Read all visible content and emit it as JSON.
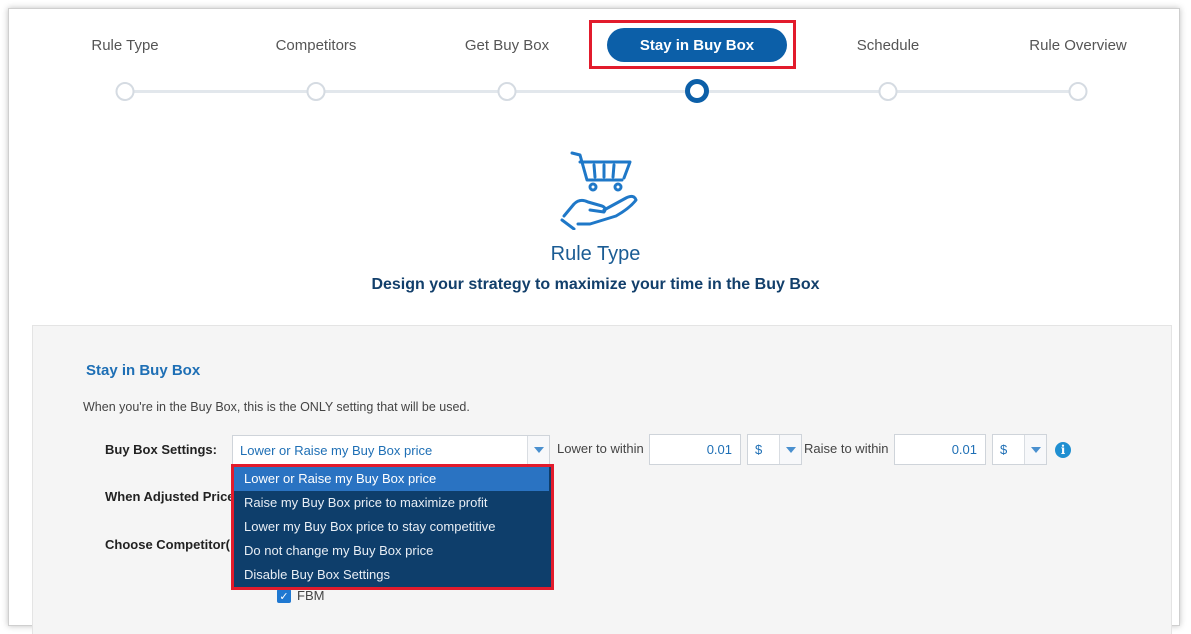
{
  "steps": [
    {
      "label": "Rule Type"
    },
    {
      "label": "Competitors"
    },
    {
      "label": "Get Buy Box"
    },
    {
      "label": "Stay in Buy Box",
      "active": true
    },
    {
      "label": "Schedule"
    },
    {
      "label": "Rule Overview"
    }
  ],
  "hero": {
    "icon": "cart-in-hand-icon",
    "title": "Rule Type",
    "subtitle": "Design your strategy to maximize your time in the Buy Box"
  },
  "section": {
    "title": "Stay in Buy Box",
    "description": "When you're in the Buy Box, this is the ONLY setting that will be used."
  },
  "form": {
    "buy_box_label": "Buy Box Settings:",
    "buy_box_value": "Lower or Raise my Buy Box price",
    "lower_label": "Lower to within",
    "lower_value": "0.01",
    "lower_unit": "$",
    "raise_label": "Raise to within",
    "raise_value": "0.01",
    "raise_unit": "$",
    "adjusted_label": "When Adjusted Price",
    "competitor_label": "Choose Competitor(",
    "fbm_label": "FBM",
    "fbm_checked": true
  },
  "dropdown_options": [
    "Lower or Raise my Buy Box price",
    "Raise my Buy Box price to maximize profit",
    "Lower my Buy Box price to stay competitive",
    "Do not change my Buy Box price",
    "Disable Buy Box Settings"
  ],
  "colors": {
    "accent": "#0c5fa8",
    "highlight": "#e21b2c",
    "dropdown_bg": "#0e3e6b",
    "dropdown_selected": "#2a73c2"
  }
}
